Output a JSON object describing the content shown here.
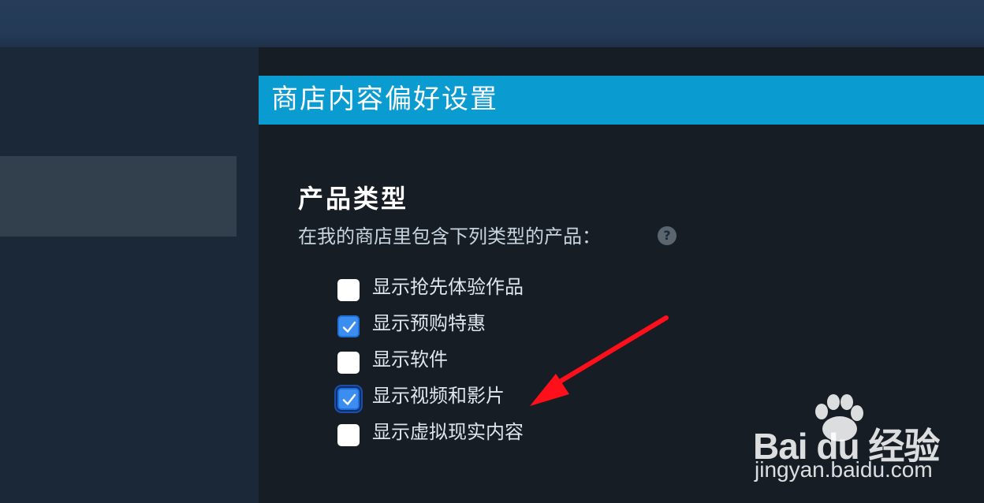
{
  "header": {
    "title": "商店内容偏好设置"
  },
  "section": {
    "heading": "产品类型",
    "description": "在我的商店里包含下列类型的产品：",
    "help_icon": "question-mark-icon"
  },
  "options": [
    {
      "label": "显示抢先体验作品",
      "checked": false
    },
    {
      "label": "显示预购特惠",
      "checked": true
    },
    {
      "label": "显示软件",
      "checked": false
    },
    {
      "label": "显示视频和影片",
      "checked": true
    },
    {
      "label": "显示虚拟现实内容",
      "checked": false
    }
  ],
  "watermark": {
    "logo_text": "Bai du 经验",
    "url": "jingyan.baidu.com"
  },
  "colors": {
    "header_blue": "#0a9bd0",
    "checkbox_checked": "#3b8ef0",
    "arrow_red": "#ff0f1a"
  }
}
